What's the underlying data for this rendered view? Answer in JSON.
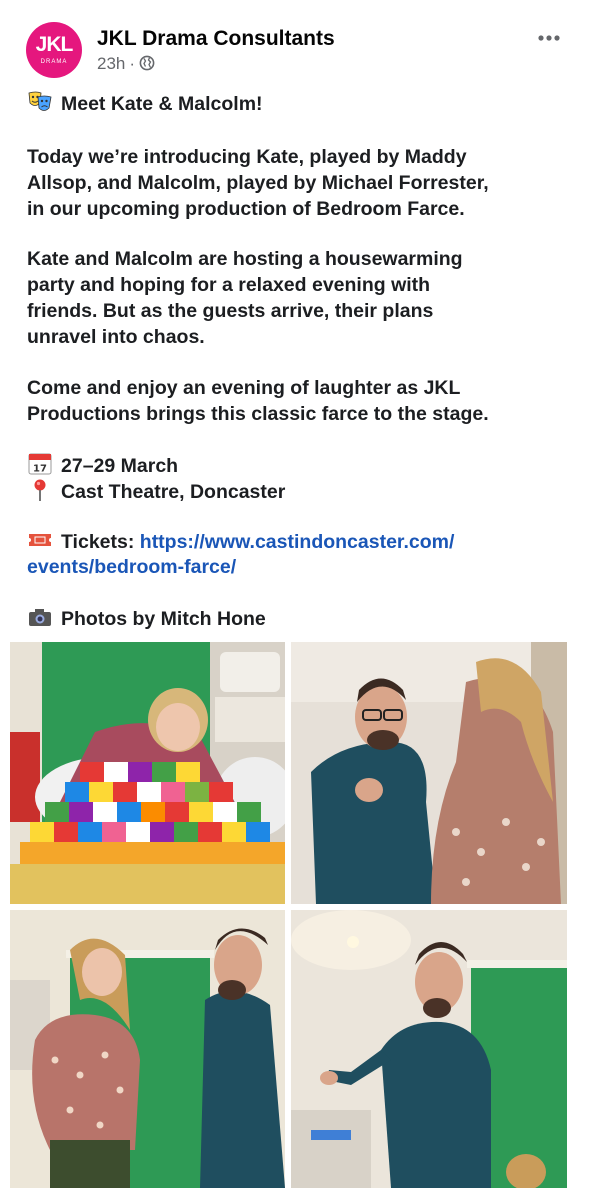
{
  "page": {
    "name": "JKL Drama Consultants",
    "time": "23h",
    "separator": "·",
    "avatar_text": "JKL",
    "avatar_subtext": "DRAMA"
  },
  "post": {
    "headline": "Meet Kate & Malcolm!",
    "para1": [
      "Today we’re introducing Kate, played by Maddy",
      "Allsop, and Malcolm, played by Michael Forrester,",
      "in our upcoming production of Bedroom Farce."
    ],
    "para2": [
      "Kate and Malcolm are hosting a housewarming",
      "party and hoping for a relaxed evening with",
      "friends. But as the guests arrive, their plans",
      "unravel into chaos."
    ],
    "para3": [
      "Come and enjoy an evening of laughter as JKL",
      "Productions brings this classic farce to the stage."
    ],
    "date": "27–29 March",
    "calendar_day": "17",
    "venue": "Cast Theatre, Doncaster",
    "tickets_label": "Tickets:",
    "tickets_url_line1": "https://www.castindoncaster.com/",
    "tickets_url_line2": "events/bedroom-farce/",
    "photos_credit": "Photos by Mitch Hone"
  },
  "icons": {
    "headline": "theater-masks-icon",
    "date": "calendar-icon",
    "venue": "round-pushpin-icon",
    "tickets": "ticket-icon",
    "photos": "camera-icon",
    "privacy": "globe-icon",
    "menu": "more-options-icon"
  },
  "colors": {
    "brand": "#e5177e",
    "link": "#1a56b7",
    "meta": "#65676b",
    "text": "#1c1e21"
  }
}
